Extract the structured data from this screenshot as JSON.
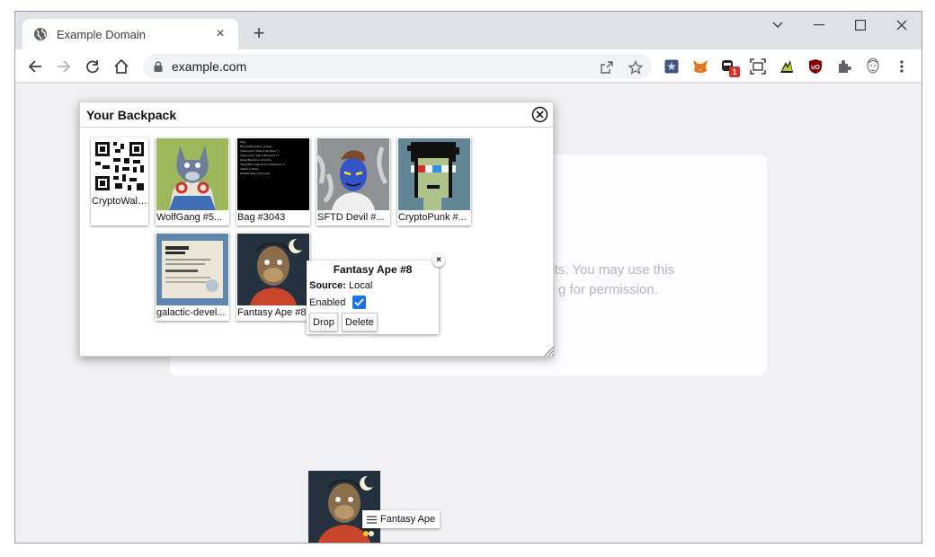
{
  "browser": {
    "tab_title": "Example Domain",
    "tab_close": "×",
    "new_tab": "+",
    "url": "example.com",
    "extension_badge": "1"
  },
  "page": {
    "text_line1": "ents. You may use this",
    "text_line2": "g for permission."
  },
  "backpack": {
    "title": "Your Backpack",
    "items": [
      {
        "label": "CryptoWallet"
      },
      {
        "label": "WolfGang #5..."
      },
      {
        "label": "Bag #3043"
      },
      {
        "label": "SFTD Devil #..."
      },
      {
        "label": "CryptoPunk #..."
      },
      {
        "label": "galactic-devel..."
      },
      {
        "label": "Fantasy Ape #8"
      }
    ]
  },
  "bag_lines": [
    "Ring",
    "Hard Leather Armor of Anger",
    "\"Rune Grasp\" Mask of the Titans +1",
    "\"Rage Grasp\" Sash of Protection +1",
    "Ornate Belt Boots of the Fox",
    "\"Dread Bite\" Silk Gloves of Brilliance +1",
    "Amulet of Titans",
    "Platinum Ring of the Twins"
  ],
  "detail_popup": {
    "title": "Fantasy Ape #8",
    "source_label": "Source:",
    "source_value": "Local",
    "enabled_label": "Enabled",
    "drop_label": "Drop",
    "delete_label": "Delete",
    "close_label": "×"
  },
  "drag": {
    "chip_label": "Fantasy Ape"
  },
  "colors": {
    "accent": "#1a73e8",
    "page_bg": "#f0f0f2"
  }
}
